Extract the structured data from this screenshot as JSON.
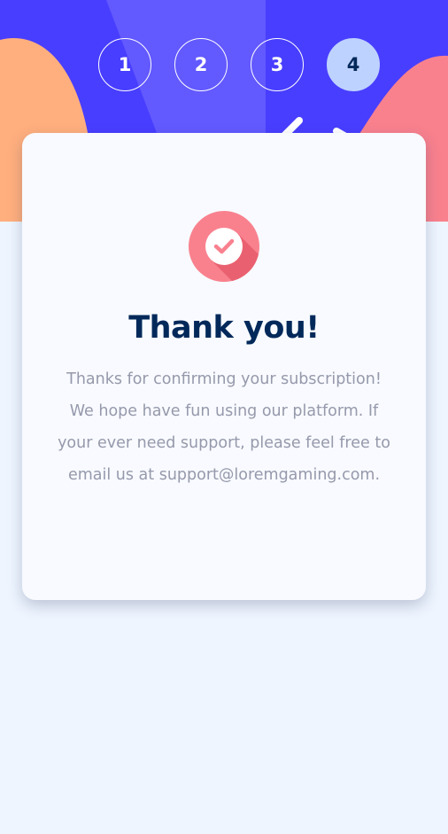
{
  "steps": [
    "1",
    "2",
    "3",
    "4"
  ],
  "active_step": "4",
  "confirmation": {
    "title": "Thank you!",
    "message": "Thanks for confirming your subscription! We hope have fun using our platform. If your ever need support, please feel free to email us at support@loremgaming.com."
  },
  "colors": {
    "accent": "#483eff",
    "accent_light": "#6259ff",
    "orange_blob": "#ffaf7e",
    "pink_blob": "#f9818e",
    "marine_blue": "#02295a",
    "step_active_bg": "#bed2ff",
    "text_muted": "#9699ab",
    "page_bg": "#eef5ff",
    "card_bg": "#f8faff"
  },
  "icons": {
    "confirmation": "checkmark-circle-icon"
  }
}
